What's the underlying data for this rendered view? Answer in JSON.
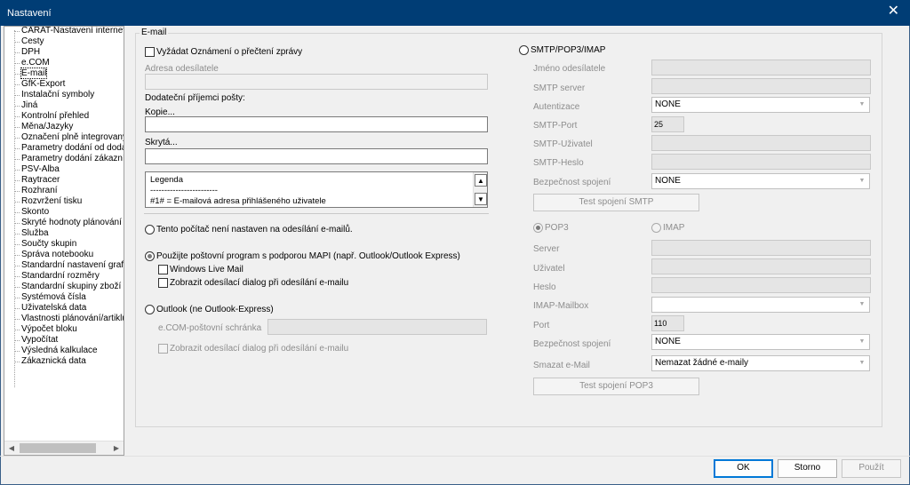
{
  "window": {
    "title": "Nastavení",
    "close_glyph": "✕"
  },
  "tree": {
    "items": [
      "CARAT-Nastavení internetu",
      "Cesty",
      "DPH",
      "e.COM",
      "E-mail",
      "GfK-Export",
      "Instalační symboly",
      "Jiná",
      "Kontrolní přehled",
      "Měna/Jazyky",
      "Označení plně integrovaných",
      "Parametry dodání od dodavatele",
      "Parametry dodání zákazníkovi",
      "PSV-Alba",
      "Raytracer",
      "Rozhraní",
      "Rozvržení tisku",
      "Skonto",
      "Skryté hodnoty plánování",
      "Služba",
      "Součty skupin",
      "Správa notebooku",
      "Standardní nastavení grafiky",
      "Standardní rozměry",
      "Standardní skupiny zboží",
      "Systémová čísla",
      "Uživatelská data",
      "Vlastnosti plánování/artiklů",
      "Výpočet bloku",
      "Vypočítat",
      "Výsledná kalkulace",
      "Zákaznická data"
    ],
    "selected_index": 4,
    "scroll_left": "◀",
    "scroll_right": "▶"
  },
  "email": {
    "group_title": "E-mail",
    "read_receipt": "Vyžádat Oznámení o přečtení zprávy",
    "sender_address_label": "Adresa odesílatele",
    "sender_address_value": "",
    "additional_recipients": "Dodateční příjemci pošty:",
    "copy_label": "Kopie...",
    "copy_value": "",
    "hidden_label": "Skrytá...",
    "hidden_value": "",
    "legend_lines": [
      "Legenda",
      "------------------------",
      "#1# = E-mailová adresa přihlášeného uživatele"
    ],
    "legend_up": "▲",
    "legend_down": "▼",
    "option_not_set": "Tento počítač není nastaven na odesílání e-mailů.",
    "option_mapi": "Použijte poštovní program s podporou MAPI (např. Outlook/Outlook Express)",
    "windows_live_mail": "Windows Live Mail",
    "show_send_dialog": "Zobrazit odesílací dialog při odesílání e-mailu",
    "option_outlook": "Outlook (ne Outlook-Express)",
    "ecom_mailbox_label": "e.COM-poštovní schránka",
    "ecom_mailbox_value": "",
    "show_send_dialog_2": "Zobrazit odesílací dialog při odesílání e-mailu"
  },
  "smtp": {
    "option_label": "SMTP/POP3/IMAP",
    "sender_name_label": "Jméno odesílatele",
    "server_label": "SMTP server",
    "auth_label": "Autentizace",
    "auth_value": "NONE",
    "port_label": "SMTP-Port",
    "port_value": "25",
    "user_label": "SMTP-Uživatel",
    "password_label": "SMTP-Heslo",
    "security_label": "Bezpečnost spojení",
    "security_value": "NONE",
    "test_button": "Test spojení SMTP",
    "dropdown_glyph": "▼"
  },
  "pop": {
    "pop3_label": "POP3",
    "imap_label": "IMAP",
    "server_label": "Server",
    "user_label": "Uživatel",
    "password_label": "Heslo",
    "mailbox_label": "IMAP-Mailbox",
    "port_label": "Port",
    "port_value": "110",
    "security_label": "Bezpečnost spojení",
    "security_value": "NONE",
    "delete_label": "Smazat e-Mail",
    "delete_value": "Nemazat žádné e-maily",
    "test_button": "Test spojení POP3"
  },
  "footer": {
    "ok": "OK",
    "cancel": "Storno",
    "apply": "Použít"
  },
  "colors": {
    "titlebar": "#003d75",
    "accent": "#0078d7"
  }
}
